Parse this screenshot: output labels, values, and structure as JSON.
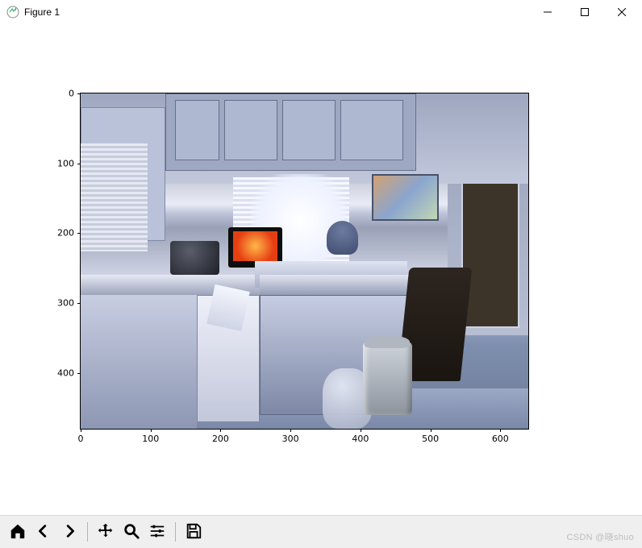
{
  "window": {
    "title": "Figure 1"
  },
  "toolbar": {
    "home": "Home",
    "back": "Back",
    "forward": "Forward",
    "pan": "Pan",
    "zoom": "Zoom",
    "configure": "Configure subplots",
    "save": "Save"
  },
  "watermark": "CSDN @晓shuo",
  "chart_data": {
    "type": "image",
    "description": "Photograph of a kitchen interior displayed in a matplotlib image axes (imshow). Origin is upper-left so y increases downward.",
    "xlim": [
      0,
      640
    ],
    "ylim": [
      480,
      0
    ],
    "xticks": [
      0,
      100,
      200,
      300,
      400,
      500,
      600
    ],
    "yticks": [
      0,
      100,
      200,
      300,
      400
    ],
    "xlabel": "",
    "ylabel": "",
    "title": ""
  }
}
